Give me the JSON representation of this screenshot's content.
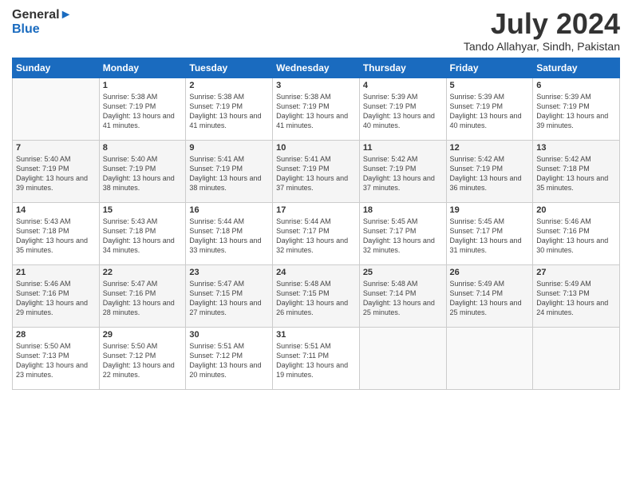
{
  "logo": {
    "line1": "General",
    "line2": "Blue"
  },
  "title": "July 2024",
  "location": "Tando Allahyar, Sindh, Pakistan",
  "days_of_week": [
    "Sunday",
    "Monday",
    "Tuesday",
    "Wednesday",
    "Thursday",
    "Friday",
    "Saturday"
  ],
  "weeks": [
    [
      {
        "day": "",
        "sunrise": "",
        "sunset": "",
        "daylight": ""
      },
      {
        "day": "1",
        "sunrise": "Sunrise: 5:38 AM",
        "sunset": "Sunset: 7:19 PM",
        "daylight": "Daylight: 13 hours and 41 minutes."
      },
      {
        "day": "2",
        "sunrise": "Sunrise: 5:38 AM",
        "sunset": "Sunset: 7:19 PM",
        "daylight": "Daylight: 13 hours and 41 minutes."
      },
      {
        "day": "3",
        "sunrise": "Sunrise: 5:38 AM",
        "sunset": "Sunset: 7:19 PM",
        "daylight": "Daylight: 13 hours and 41 minutes."
      },
      {
        "day": "4",
        "sunrise": "Sunrise: 5:39 AM",
        "sunset": "Sunset: 7:19 PM",
        "daylight": "Daylight: 13 hours and 40 minutes."
      },
      {
        "day": "5",
        "sunrise": "Sunrise: 5:39 AM",
        "sunset": "Sunset: 7:19 PM",
        "daylight": "Daylight: 13 hours and 40 minutes."
      },
      {
        "day": "6",
        "sunrise": "Sunrise: 5:39 AM",
        "sunset": "Sunset: 7:19 PM",
        "daylight": "Daylight: 13 hours and 39 minutes."
      }
    ],
    [
      {
        "day": "7",
        "sunrise": "Sunrise: 5:40 AM",
        "sunset": "Sunset: 7:19 PM",
        "daylight": "Daylight: 13 hours and 39 minutes."
      },
      {
        "day": "8",
        "sunrise": "Sunrise: 5:40 AM",
        "sunset": "Sunset: 7:19 PM",
        "daylight": "Daylight: 13 hours and 38 minutes."
      },
      {
        "day": "9",
        "sunrise": "Sunrise: 5:41 AM",
        "sunset": "Sunset: 7:19 PM",
        "daylight": "Daylight: 13 hours and 38 minutes."
      },
      {
        "day": "10",
        "sunrise": "Sunrise: 5:41 AM",
        "sunset": "Sunset: 7:19 PM",
        "daylight": "Daylight: 13 hours and 37 minutes."
      },
      {
        "day": "11",
        "sunrise": "Sunrise: 5:42 AM",
        "sunset": "Sunset: 7:19 PM",
        "daylight": "Daylight: 13 hours and 37 minutes."
      },
      {
        "day": "12",
        "sunrise": "Sunrise: 5:42 AM",
        "sunset": "Sunset: 7:19 PM",
        "daylight": "Daylight: 13 hours and 36 minutes."
      },
      {
        "day": "13",
        "sunrise": "Sunrise: 5:42 AM",
        "sunset": "Sunset: 7:18 PM",
        "daylight": "Daylight: 13 hours and 35 minutes."
      }
    ],
    [
      {
        "day": "14",
        "sunrise": "Sunrise: 5:43 AM",
        "sunset": "Sunset: 7:18 PM",
        "daylight": "Daylight: 13 hours and 35 minutes."
      },
      {
        "day": "15",
        "sunrise": "Sunrise: 5:43 AM",
        "sunset": "Sunset: 7:18 PM",
        "daylight": "Daylight: 13 hours and 34 minutes."
      },
      {
        "day": "16",
        "sunrise": "Sunrise: 5:44 AM",
        "sunset": "Sunset: 7:18 PM",
        "daylight": "Daylight: 13 hours and 33 minutes."
      },
      {
        "day": "17",
        "sunrise": "Sunrise: 5:44 AM",
        "sunset": "Sunset: 7:17 PM",
        "daylight": "Daylight: 13 hours and 32 minutes."
      },
      {
        "day": "18",
        "sunrise": "Sunrise: 5:45 AM",
        "sunset": "Sunset: 7:17 PM",
        "daylight": "Daylight: 13 hours and 32 minutes."
      },
      {
        "day": "19",
        "sunrise": "Sunrise: 5:45 AM",
        "sunset": "Sunset: 7:17 PM",
        "daylight": "Daylight: 13 hours and 31 minutes."
      },
      {
        "day": "20",
        "sunrise": "Sunrise: 5:46 AM",
        "sunset": "Sunset: 7:16 PM",
        "daylight": "Daylight: 13 hours and 30 minutes."
      }
    ],
    [
      {
        "day": "21",
        "sunrise": "Sunrise: 5:46 AM",
        "sunset": "Sunset: 7:16 PM",
        "daylight": "Daylight: 13 hours and 29 minutes."
      },
      {
        "day": "22",
        "sunrise": "Sunrise: 5:47 AM",
        "sunset": "Sunset: 7:16 PM",
        "daylight": "Daylight: 13 hours and 28 minutes."
      },
      {
        "day": "23",
        "sunrise": "Sunrise: 5:47 AM",
        "sunset": "Sunset: 7:15 PM",
        "daylight": "Daylight: 13 hours and 27 minutes."
      },
      {
        "day": "24",
        "sunrise": "Sunrise: 5:48 AM",
        "sunset": "Sunset: 7:15 PM",
        "daylight": "Daylight: 13 hours and 26 minutes."
      },
      {
        "day": "25",
        "sunrise": "Sunrise: 5:48 AM",
        "sunset": "Sunset: 7:14 PM",
        "daylight": "Daylight: 13 hours and 25 minutes."
      },
      {
        "day": "26",
        "sunrise": "Sunrise: 5:49 AM",
        "sunset": "Sunset: 7:14 PM",
        "daylight": "Daylight: 13 hours and 25 minutes."
      },
      {
        "day": "27",
        "sunrise": "Sunrise: 5:49 AM",
        "sunset": "Sunset: 7:13 PM",
        "daylight": "Daylight: 13 hours and 24 minutes."
      }
    ],
    [
      {
        "day": "28",
        "sunrise": "Sunrise: 5:50 AM",
        "sunset": "Sunset: 7:13 PM",
        "daylight": "Daylight: 13 hours and 23 minutes."
      },
      {
        "day": "29",
        "sunrise": "Sunrise: 5:50 AM",
        "sunset": "Sunset: 7:12 PM",
        "daylight": "Daylight: 13 hours and 22 minutes."
      },
      {
        "day": "30",
        "sunrise": "Sunrise: 5:51 AM",
        "sunset": "Sunset: 7:12 PM",
        "daylight": "Daylight: 13 hours and 20 minutes."
      },
      {
        "day": "31",
        "sunrise": "Sunrise: 5:51 AM",
        "sunset": "Sunset: 7:11 PM",
        "daylight": "Daylight: 13 hours and 19 minutes."
      },
      {
        "day": "",
        "sunrise": "",
        "sunset": "",
        "daylight": ""
      },
      {
        "day": "",
        "sunrise": "",
        "sunset": "",
        "daylight": ""
      },
      {
        "day": "",
        "sunrise": "",
        "sunset": "",
        "daylight": ""
      }
    ]
  ]
}
